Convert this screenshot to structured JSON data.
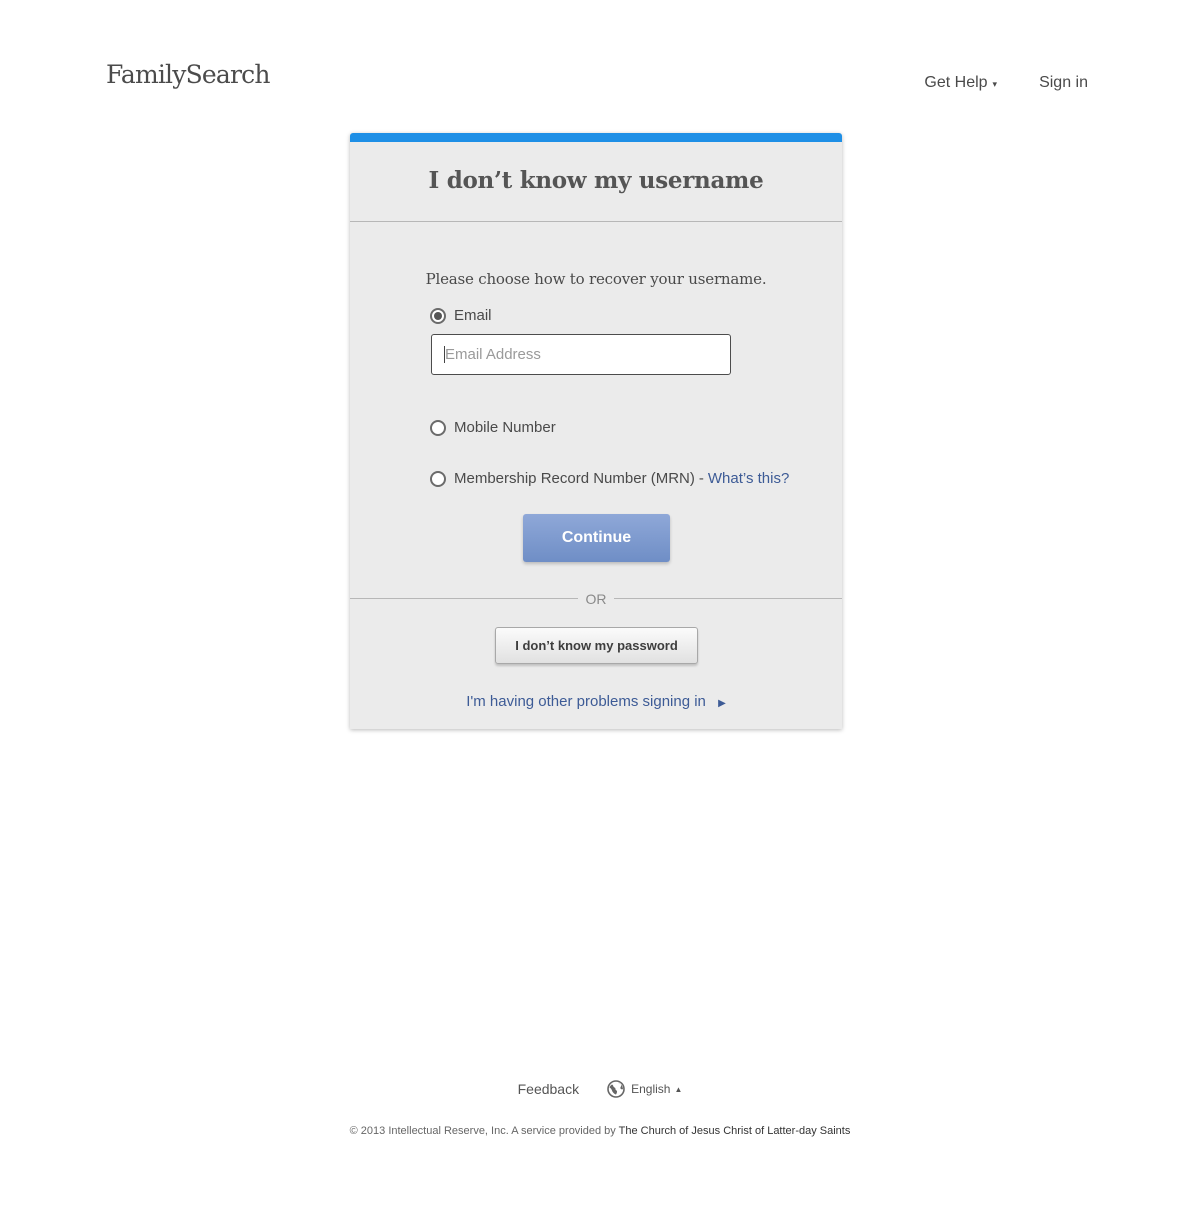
{
  "header": {
    "logo": "FamilySearch",
    "nav": {
      "get_help": "Get Help",
      "get_help_caret": "▾",
      "sign_in": "Sign in"
    }
  },
  "card": {
    "accent_color": "#1e8fe6",
    "title": "I don’t know my username",
    "prompt": "Please choose how to recover your username.",
    "options": {
      "email": "Email",
      "mobile": "Mobile Number",
      "mrn": "Membership Record Number (MRN)",
      "mrn_separator": "-",
      "mrn_help_link": "What’s this?"
    },
    "selected_option": "email",
    "email_input": {
      "value": "",
      "placeholder": "Email Address"
    },
    "continue_label": "Continue",
    "or_label": "OR",
    "password_button": "I don’t know my password",
    "problems_link": "I'm having other problems signing in",
    "problems_arrow": "▶"
  },
  "footer": {
    "feedback": "Feedback",
    "language": "English",
    "language_caret": "▲",
    "copyright": "© 2013 Intellectual Reserve, Inc.  A service provided by",
    "church": "The Church of Jesus Christ of Latter-day Saints"
  }
}
